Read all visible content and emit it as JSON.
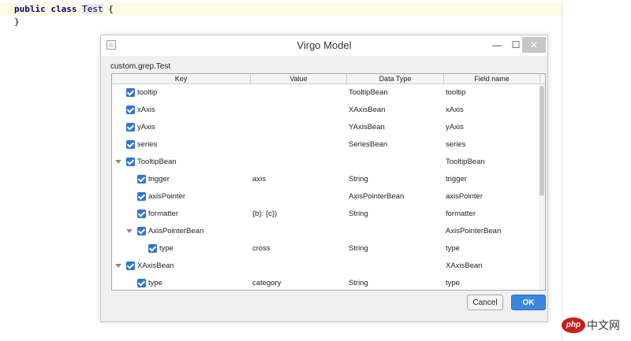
{
  "editor": {
    "line1": {
      "kw1": "public",
      "kw2": "class",
      "cls": "Test",
      "tail": " {"
    },
    "line2": "}"
  },
  "dialog": {
    "title": "Virgo Model",
    "icon_glyph": "♨",
    "min": "—",
    "max": "☐",
    "close": "✕",
    "path": "custom.grep.Test",
    "columns": [
      "Key",
      "Value",
      "Data Type",
      "Field name"
    ],
    "rows": [
      {
        "key": "tooltip",
        "value": "",
        "type": "TooltipBean",
        "field": "tooltip"
      },
      {
        "key": "xAxis",
        "value": "",
        "type": "XAxisBean",
        "field": "xAxis"
      },
      {
        "key": "yAxis",
        "value": "",
        "type": "YAxisBean",
        "field": "yAxis"
      },
      {
        "key": "series",
        "value": "",
        "type": "SeriesBean",
        "field": "series"
      },
      {
        "key": "TooltipBean",
        "value": "",
        "type": "",
        "field": "TooltipBean"
      },
      {
        "key": "trigger",
        "value": "axis",
        "type": "String",
        "field": "trigger"
      },
      {
        "key": "axisPointer",
        "value": "",
        "type": "AxisPointerBean",
        "field": "axisPointer"
      },
      {
        "key": "formatter",
        "value": "{b}: {c})",
        "type": "String",
        "field": "formatter"
      },
      {
        "key": "AxisPointerBean",
        "value": "",
        "type": "",
        "field": "AxisPointerBean"
      },
      {
        "key": "type",
        "value": "cross",
        "type": "String",
        "field": "type"
      },
      {
        "key": "XAxisBean",
        "value": "",
        "type": "",
        "field": "XAxisBean"
      },
      {
        "key": "type",
        "value": "category",
        "type": "String",
        "field": "type"
      }
    ],
    "cancel_label": "Cancel",
    "ok_label": "OK"
  },
  "watermark": {
    "logo": "php",
    "text": "中文网"
  },
  "colors": {
    "checkbox": "#2f75d6",
    "ok_button": "#3b87e0",
    "watermark": "#c81e1e"
  }
}
